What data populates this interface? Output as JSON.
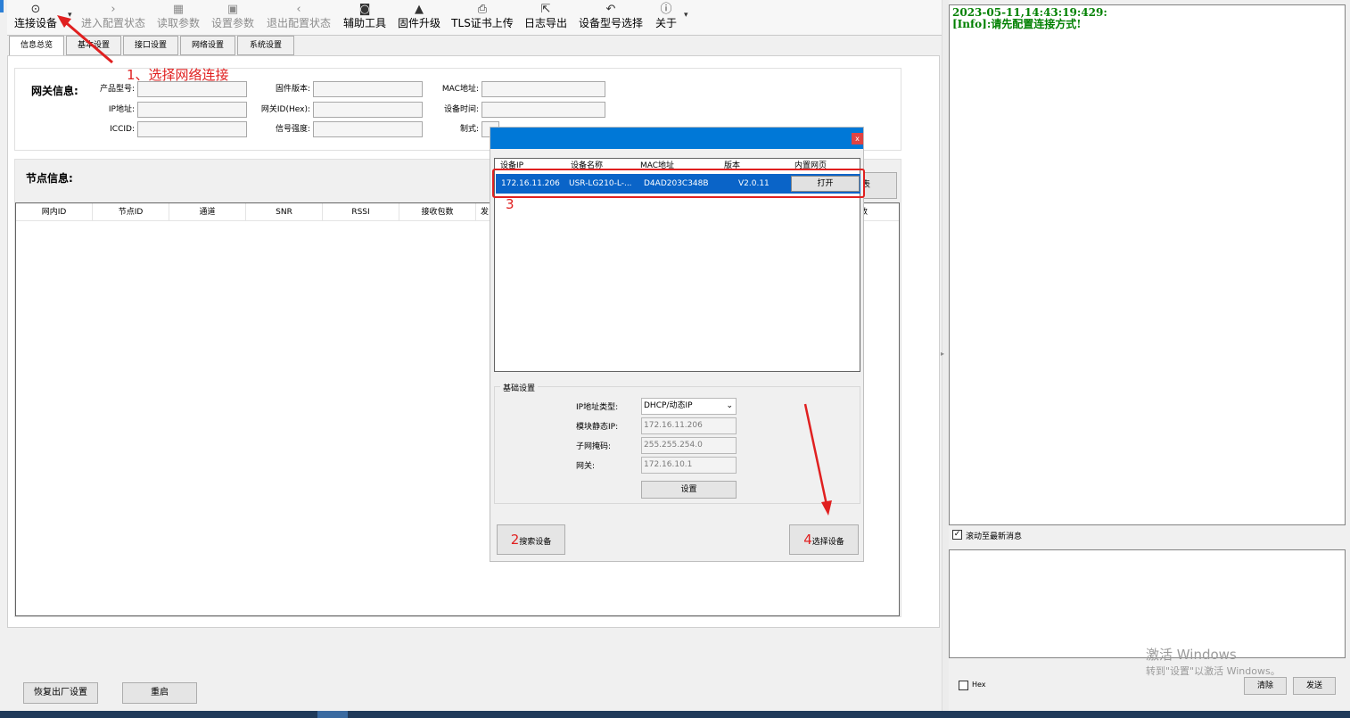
{
  "toolbar": {
    "items": [
      {
        "label": "连接设备",
        "icon": "location-pin-icon"
      },
      {
        "label": "进入配置状态",
        "icon": "chevron-right-icon"
      },
      {
        "label": "读取参数",
        "icon": "read-params-icon"
      },
      {
        "label": "设置参数",
        "icon": "save-icon"
      },
      {
        "label": "退出配置状态",
        "icon": "chevron-left-icon"
      },
      {
        "label": "辅助工具",
        "icon": "camera-tool-icon"
      },
      {
        "label": "固件升级",
        "icon": "rocket-icon"
      },
      {
        "label": "TLS证书上传",
        "icon": "certificate-icon"
      },
      {
        "label": "日志导出",
        "icon": "export-icon"
      },
      {
        "label": "设备型号选择",
        "icon": "undo-arrow-icon"
      },
      {
        "label": "关于",
        "icon": "info-icon"
      }
    ]
  },
  "tabs": [
    "信息总览",
    "基本设置",
    "接口设置",
    "网络设置",
    "系统设置"
  ],
  "gateway": {
    "title": "网关信息:",
    "labels": {
      "product_model": "产品型号:",
      "ip": "IP地址:",
      "iccid": "ICCID:",
      "firmware": "固件版本:",
      "gateway_id": "网关ID(Hex):",
      "signal": "信号强度:",
      "mac": "MAC地址:",
      "device_time": "设备时间:",
      "standard": "制式:"
    }
  },
  "nodes": {
    "title": "节点信息:",
    "columns": [
      "网内ID",
      "节点ID",
      "通道",
      "SNR",
      "RSSI",
      "接收包数",
      "发"
    ],
    "partial_button": "表",
    "partial_column": "数"
  },
  "bottom": {
    "factory_reset": "恢复出厂设置",
    "restart": "重启"
  },
  "dialog": {
    "close": "x",
    "columns": [
      "设备IP",
      "设备名称",
      "MAC地址",
      "版本",
      "内置网页"
    ],
    "row": {
      "ip": "172.16.11.206",
      "name": "USR-LG210-L-...",
      "mac": "D4AD203C348B",
      "version": "V2.0.11",
      "open": "打开"
    },
    "basic": {
      "title": "基础设置",
      "ip_type_label": "IP地址类型:",
      "ip_type_value": "DHCP/动态IP",
      "static_ip_label": "模块静态IP:",
      "static_ip_value": "172.16.11.206",
      "mask_label": "子网掩码:",
      "mask_value": "255.255.254.0",
      "gateway_label": "网关:",
      "gateway_value": "172.16.10.1",
      "set_button": "设置"
    },
    "search_button": "搜索设备",
    "select_button": "选择设备"
  },
  "annotations": {
    "step1": "1、选择网络连接",
    "step2": "2",
    "step3": "3",
    "step4": "4"
  },
  "log": {
    "line1": "2023-05-11,14:43:19:429:",
    "line2": "[Info]:请先配置连接方式!"
  },
  "right": {
    "scroll_latest": "滚动至最新消息",
    "hex": "Hex",
    "clear": "清除",
    "send": "发送"
  },
  "watermark": {
    "line1": "激活 Windows",
    "line2": "转到\"设置\"以激活 Windows。"
  },
  "colors": {
    "accent": "#0078d7",
    "selection": "#0a64c8",
    "annotation": "#e02020",
    "log_text": "#008000"
  }
}
